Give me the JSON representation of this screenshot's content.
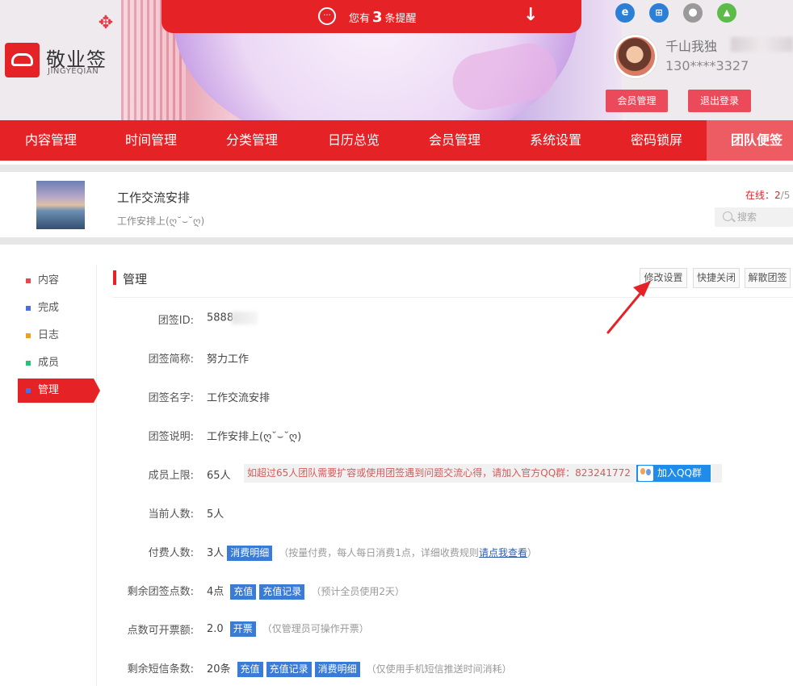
{
  "brand": {
    "name_cn": "敬业签",
    "name_en": "JINGYEQIAN"
  },
  "alert": {
    "prefix": "您有",
    "count": "3",
    "suffix": "条提醒"
  },
  "platforms": [
    "ie-icon",
    "windows-icon",
    "apple-icon",
    "android-icon"
  ],
  "user": {
    "name": "千山我独",
    "phone": "130****3327",
    "member_btn": "会员管理",
    "logout_btn": "退出登录"
  },
  "nav": {
    "items": [
      "内容管理",
      "时间管理",
      "分类管理",
      "日历总览",
      "会员管理",
      "系统设置",
      "密码锁屏"
    ],
    "active": "团队便签"
  },
  "team": {
    "title": "工作交流安排",
    "subtitle": "工作安排上(ღ˘⌣˘ღ)",
    "online_label": "在线：",
    "online_count": "2",
    "online_total": "5",
    "search_placeholder": "搜索"
  },
  "sidebar": {
    "items": [
      {
        "label": "内容",
        "color": "#e24a4a"
      },
      {
        "label": "完成",
        "color": "#4a6fe2"
      },
      {
        "label": "日志",
        "color": "#f0a020"
      },
      {
        "label": "成员",
        "color": "#2bc07a"
      },
      {
        "label": "管理",
        "color": "#4a6fe2"
      }
    ],
    "active_index": 4
  },
  "manage": {
    "title": "管理",
    "buttons": {
      "edit": "修改设置",
      "quick_close": "快捷关闭",
      "dissolve": "解散团签"
    },
    "rows": {
      "id": {
        "label": "团签ID:",
        "value": "5888"
      },
      "short_name": {
        "label": "团签简称:",
        "value": "努力工作"
      },
      "name": {
        "label": "团签名字:",
        "value": "工作交流安排"
      },
      "desc": {
        "label": "团签说明:",
        "value": "工作安排上(ღ˘⌣˘ღ)"
      },
      "limit": {
        "label": "成员上限:",
        "value": "65人",
        "warning": "如超过65人团队需要扩容或使用团签遇到问题交流心得，请加入官方QQ群：823241772",
        "qq_btn": "加入QQ群"
      },
      "current": {
        "label": "当前人数:",
        "value": "5人"
      },
      "paid": {
        "label": "付费人数:",
        "value": "3人",
        "tag": "消费明细",
        "note_pre": "（按量付费，每人每日消费1点，详细收费规则",
        "note_link": "请点我查看",
        "note_post": "）"
      },
      "points": {
        "label": "剩余团签点数:",
        "value": "4点",
        "tag1": "充值",
        "tag2": "充值记录",
        "note": "（预计全员使用2天）"
      },
      "invoice": {
        "label": "点数可开票额:",
        "value": "2.0",
        "tag": "开票",
        "note": "（仅管理员可操作开票）"
      },
      "sms": {
        "label": "剩余短信条数:",
        "value": "20条",
        "tag1": "充值",
        "tag2": "充值记录",
        "tag3": "消费明细",
        "note": "（仅使用手机短信推送时间消耗）"
      }
    }
  },
  "colors": {
    "brand_red": "#e52226",
    "nav_active": "#ee5c63",
    "tag_blue": "#3a7bd5",
    "qq_blue": "#1e8ce8"
  }
}
